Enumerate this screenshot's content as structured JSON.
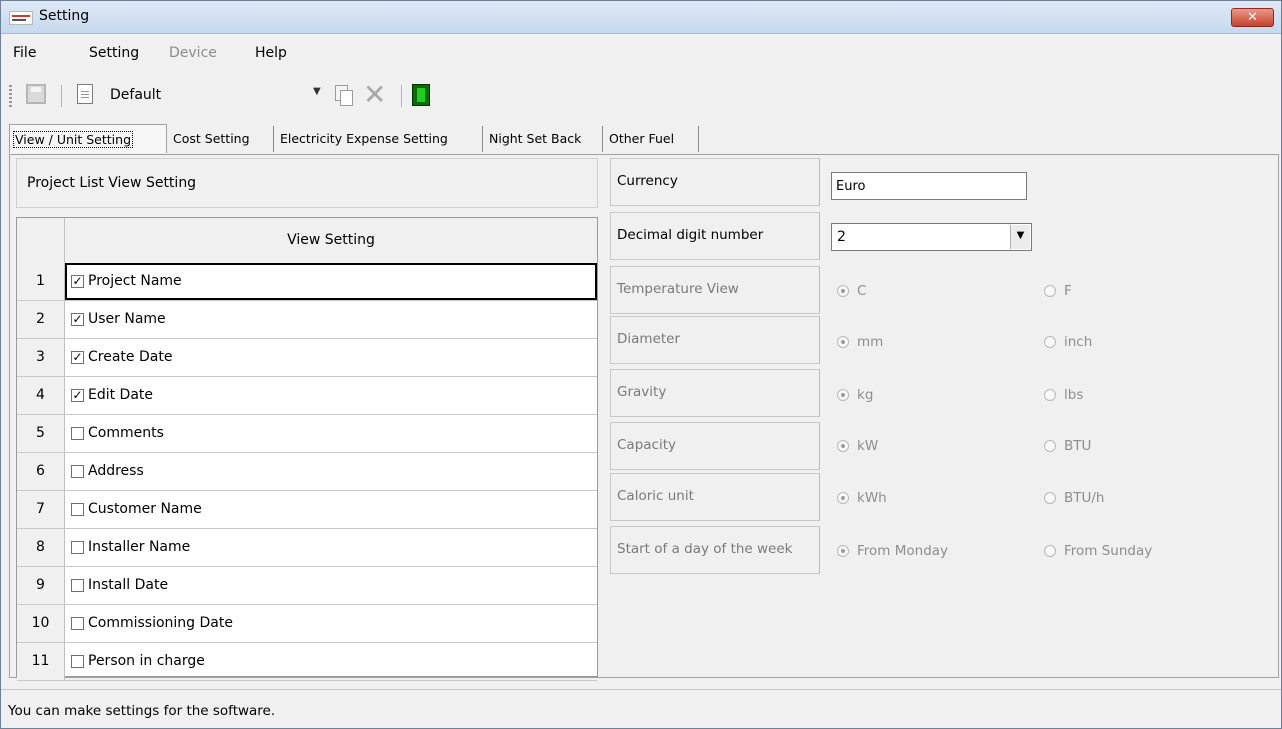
{
  "window": {
    "title": "Setting",
    "close_label": "✕"
  },
  "menu": [
    {
      "label": "File",
      "enabled": true
    },
    {
      "label": "Setting",
      "enabled": true
    },
    {
      "label": "Device",
      "enabled": false
    },
    {
      "label": "Help",
      "enabled": true
    }
  ],
  "toolbar": {
    "profile_value": "Default",
    "icons": [
      "save-icon",
      "new-document-icon",
      "copy-icon",
      "delete-icon",
      "device-icon"
    ]
  },
  "tabs": [
    {
      "label": "View / Unit Setting",
      "active": true
    },
    {
      "label": "Cost Setting",
      "active": false
    },
    {
      "label": "Electricity Expense Setting",
      "active": false
    },
    {
      "label": "Night Set Back",
      "active": false
    },
    {
      "label": "Other Fuel",
      "active": false
    }
  ],
  "project_list": {
    "header": "Project List View Setting",
    "column_title": "View Setting",
    "rows": [
      {
        "num": "1",
        "label": "Project Name",
        "checked": true
      },
      {
        "num": "2",
        "label": "User Name",
        "checked": true
      },
      {
        "num": "3",
        "label": "Create Date",
        "checked": true
      },
      {
        "num": "4",
        "label": "Edit Date",
        "checked": true
      },
      {
        "num": "5",
        "label": "Comments",
        "checked": false
      },
      {
        "num": "6",
        "label": "Address",
        "checked": false
      },
      {
        "num": "7",
        "label": "Customer Name",
        "checked": false
      },
      {
        "num": "8",
        "label": "Installer Name",
        "checked": false
      },
      {
        "num": "9",
        "label": "Install Date",
        "checked": false
      },
      {
        "num": "10",
        "label": "Commissioning Date",
        "checked": false
      },
      {
        "num": "11",
        "label": "Person in charge",
        "checked": false
      }
    ]
  },
  "settings": {
    "currency_label": "Currency",
    "currency_value": "Euro",
    "decimal_label": "Decimal digit number",
    "decimal_value": "2",
    "options": [
      {
        "label": "Temperature View",
        "a": "C",
        "b": "F"
      },
      {
        "label": "Diameter",
        "a": "mm",
        "b": "inch"
      },
      {
        "label": "Gravity",
        "a": "kg",
        "b": "lbs"
      },
      {
        "label": "Capacity",
        "a": "kW",
        "b": "BTU"
      },
      {
        "label": "Caloric unit",
        "a": "kWh",
        "b": "BTU/h"
      },
      {
        "label": "Start of a day of the week",
        "a": "From Monday",
        "b": "From Sunday"
      }
    ]
  },
  "status": {
    "text": "You can make settings for the software."
  }
}
